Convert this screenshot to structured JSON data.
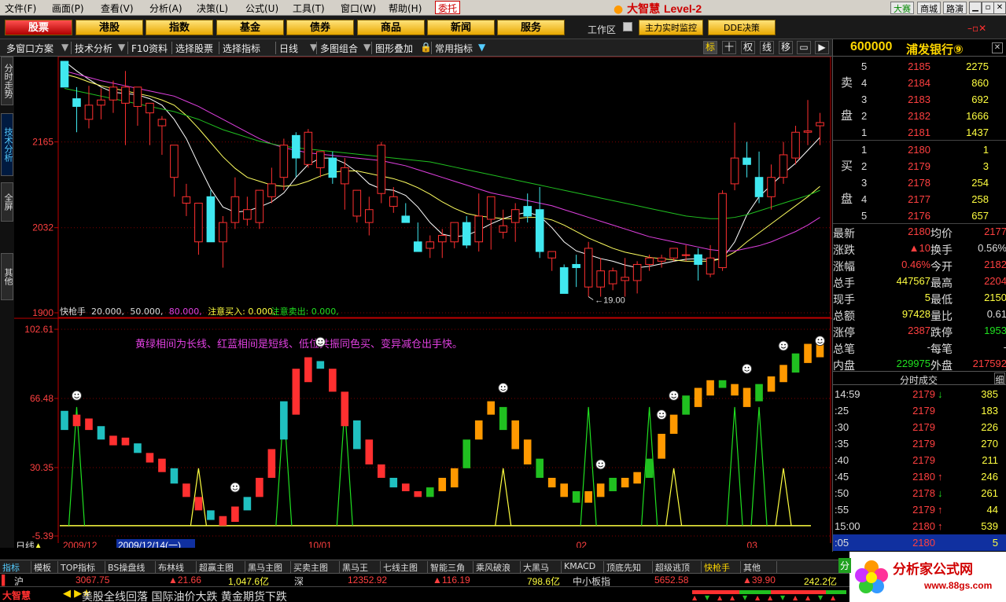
{
  "menu": {
    "items": [
      "文件(F)",
      "画面(P)",
      "查看(V)",
      "分析(A)",
      "决策(L)",
      "公式(U)",
      "工具(T)",
      "窗口(W)",
      "帮助(H)"
    ],
    "trust_tag": "委托",
    "app_title": "大智慧",
    "app_level": "Level-2",
    "right_buttons": [
      "大赛",
      "商城",
      "路演"
    ]
  },
  "nav": {
    "buttons": [
      "股票",
      "港股",
      "指数",
      "基金",
      "债券",
      "商品",
      "新闻",
      "服务"
    ],
    "workspace_label": "工作区",
    "extra_buttons": [
      "主力实时监控",
      "DDE决策"
    ]
  },
  "toolbar": {
    "items": [
      "多窗口方案",
      "技术分析",
      "F10资料",
      "选择股票",
      "选择指标",
      "日线",
      "多图组合",
      "图形叠加",
      "常用指标"
    ],
    "icons": [
      "标",
      "十",
      "权",
      "线",
      "移"
    ]
  },
  "vtabs": [
    "分时走势",
    "技术分析",
    "全屏",
    "其他"
  ],
  "chart_data": [
    {
      "type": "candlestick",
      "title": "",
      "y_ticks": [
        2165,
        2032,
        1900
      ],
      "ylim": [
        1900,
        2290
      ],
      "annotation": "19.00",
      "x_labels": [
        "2009/12",
        "2009/12/14(一)",
        "10/01",
        "02",
        "03"
      ],
      "x_label_slots": [
        0,
        6,
        20,
        42,
        56
      ],
      "candles": [
        [
          2290,
          2290,
          2260,
          2250
        ],
        [
          2232,
          2250,
          2180,
          2220
        ],
        [
          2200,
          2252,
          2186,
          2222
        ],
        [
          2222,
          2248,
          2200,
          2230
        ],
        [
          2230,
          2260,
          2210,
          2250
        ],
        [
          2225,
          2275,
          2160,
          2250
        ],
        [
          2220,
          2245,
          2190,
          2250
        ],
        [
          2210,
          2225,
          2160,
          2225
        ],
        [
          2190,
          2205,
          2145,
          2200
        ],
        [
          2110,
          2150,
          2080,
          2160
        ],
        [
          2070,
          2100,
          2050,
          2080
        ],
        [
          2010,
          2030,
          1990,
          2070
        ],
        [
          2080,
          2090,
          2010,
          2010
        ],
        [
          2010,
          2050,
          1970,
          2040
        ],
        [
          2040,
          2110,
          2030,
          2080
        ],
        [
          2045,
          2080,
          2035,
          2060
        ],
        [
          2040,
          2090,
          2030,
          2090
        ],
        [
          2080,
          2125,
          2070,
          2100
        ],
        [
          2110,
          2170,
          2090,
          2160
        ],
        [
          2175,
          2180,
          2110,
          2140
        ],
        [
          2130,
          2185,
          2125,
          2180
        ],
        [
          2125,
          2140,
          2110,
          2150
        ],
        [
          2140,
          2150,
          2100,
          2110
        ],
        [
          2100,
          2140,
          2060,
          2125
        ],
        [
          2050,
          2080,
          2040,
          2090
        ],
        [
          2040,
          2080,
          2020,
          2060
        ],
        [
          2085,
          2165,
          2070,
          2160
        ],
        [
          2065,
          2095,
          2055,
          2080
        ],
        [
          2050,
          2070,
          2040,
          2040
        ],
        [
          2010,
          2040,
          2000,
          1995
        ],
        [
          2000,
          2020,
          1985,
          2010
        ],
        [
          2010,
          2030,
          1985,
          2020
        ],
        [
          2010,
          2040,
          2000,
          2040
        ],
        [
          2040,
          2050,
          2000,
          2005
        ],
        [
          2010,
          2085,
          1995,
          2050
        ],
        [
          2045,
          2080,
          1998,
          2080
        ],
        [
          2025,
          2060,
          2015,
          2035
        ],
        [
          2040,
          2070,
          2010,
          2060
        ],
        [
          2065,
          2085,
          2040,
          2050
        ],
        [
          2060,
          2095,
          1985,
          1995
        ],
        [
          1985,
          1995,
          1965,
          1995
        ],
        [
          1970,
          1975,
          1940,
          1930
        ],
        [
          1975,
          1990,
          1940,
          1970
        ],
        [
          1940,
          2010,
          1925,
          2000
        ],
        [
          1940,
          1985,
          1925,
          1965
        ],
        [
          1945,
          1970,
          1935,
          1965
        ],
        [
          1950,
          1985,
          1925,
          1955
        ],
        [
          1950,
          1980,
          1930,
          1975
        ],
        [
          1975,
          1990,
          1965,
          1985
        ],
        [
          1980,
          1990,
          1970,
          1985
        ],
        [
          1985,
          2000,
          1980,
          2000
        ],
        [
          1990,
          2005,
          1980,
          1990
        ],
        [
          1990,
          2000,
          1950,
          1975
        ],
        [
          1960,
          2005,
          1955,
          1985
        ],
        [
          1970,
          2090,
          1965,
          2085
        ],
        [
          2100,
          2195,
          2090,
          2140
        ],
        [
          2140,
          2165,
          2110,
          2130
        ],
        [
          2110,
          2150,
          2070,
          2080
        ],
        [
          2080,
          2130,
          2060,
          2110
        ],
        [
          2110,
          2165,
          2100,
          2145
        ],
        [
          2140,
          2190,
          2130,
          2180
        ],
        [
          2180,
          2230,
          2160,
          2182
        ],
        [
          2190,
          2210,
          2160,
          2195
        ]
      ],
      "series": [
        {
          "values": [
            2290,
            2275,
            2262,
            2250,
            2242,
            2240,
            2238,
            2232,
            2222,
            2200,
            2170,
            2130,
            2092,
            2064,
            2056,
            2058,
            2064,
            2072,
            2086,
            2110,
            2130,
            2140,
            2140,
            2132,
            2118,
            2100,
            2092,
            2090,
            2082,
            2064,
            2040,
            2022,
            2018,
            2020,
            2028,
            2038,
            2046,
            2052,
            2056,
            2050,
            2032,
            2010,
            1996,
            1990,
            1984,
            1980,
            1974,
            1970,
            1972,
            1976,
            1980,
            1983,
            1984,
            1982,
            1984,
            2010,
            2052,
            2080,
            2098,
            2116,
            2132,
            2152,
            2172
          ]
        },
        {
          "values": [
            2270,
            2265,
            2258,
            2252,
            2248,
            2244,
            2240,
            2236,
            2230,
            2222,
            2206,
            2186,
            2164,
            2142,
            2124,
            2110,
            2104,
            2098,
            2096,
            2098,
            2104,
            2112,
            2118,
            2120,
            2120,
            2116,
            2112,
            2108,
            2102,
            2094,
            2084,
            2072,
            2062,
            2054,
            2050,
            2048,
            2046,
            2046,
            2048,
            2048,
            2044,
            2036,
            2026,
            2016,
            2008,
            2000,
            1994,
            1990,
            1986,
            1984,
            1982,
            1980,
            1980,
            1980,
            1984,
            1994,
            2010,
            2024,
            2038,
            2052,
            2066,
            2080,
            2096
          ]
        },
        {
          "values": [
            2275,
            2270,
            2265,
            2260,
            2256,
            2252,
            2248,
            2244,
            2240,
            2236,
            2228,
            2220,
            2210,
            2200,
            2190,
            2180,
            2170,
            2162,
            2156,
            2152,
            2148,
            2146,
            2144,
            2142,
            2140,
            2138,
            2136,
            2132,
            2128,
            2122,
            2116,
            2110,
            2104,
            2098,
            2092,
            2086,
            2082,
            2078,
            2074,
            2070,
            2066,
            2060,
            2054,
            2048,
            2042,
            2036,
            2030,
            2024,
            2018,
            2014,
            2010,
            2006,
            2002,
            1998,
            1996,
            1996,
            2000,
            2004,
            2010,
            2018,
            2026,
            2036,
            2048
          ]
        },
        {
          "values": [
            2248,
            2244,
            2240,
            2236,
            2232,
            2228,
            2224,
            2220,
            2216,
            2212,
            2206,
            2200,
            2192,
            2184,
            2178,
            2172,
            2166,
            2162,
            2158,
            2156,
            2154,
            2152,
            2150,
            2148,
            2146,
            2144,
            2142,
            2140,
            2138,
            2136,
            2134,
            2130,
            2126,
            2122,
            2118,
            2114,
            2110,
            2106,
            2102,
            2098,
            2094,
            2090,
            2086,
            2082,
            2078,
            2074,
            2070,
            2066,
            2062,
            2058,
            2054,
            2050,
            2048,
            2046,
            2046,
            2048,
            2052,
            2058,
            2064,
            2070,
            2076,
            2082,
            2090
          ]
        }
      ]
    },
    {
      "type": "indicator",
      "title": "快枪手",
      "params": [
        "20.000,",
        "50.000,",
        "80.000,",
        "注意买入: 0.000,",
        "注意卖出: 0.000,"
      ],
      "note": "黄绿相间为长线、红蓝相间是短线、低位共振同色买、变异减仓出手快。",
      "y_ticks": [
        "102.61",
        "66.48",
        "30.35",
        "-5.39"
      ],
      "y_tick_values": [
        102.61,
        66.48,
        30.35,
        -5.39
      ],
      "ylim": [
        -5.39,
        102.61
      ],
      "bars": [
        [
          50,
          60
        ],
        [
          52,
          58
        ],
        [
          50,
          56
        ],
        [
          45,
          52
        ],
        [
          42,
          47
        ],
        [
          42,
          46
        ],
        [
          38,
          43
        ],
        [
          33,
          38
        ],
        [
          28,
          35
        ],
        [
          22,
          30
        ],
        [
          15,
          22
        ],
        [
          8,
          15
        ],
        [
          3,
          8
        ],
        [
          0,
          5
        ],
        [
          2,
          10
        ],
        [
          8,
          15
        ],
        [
          15,
          25
        ],
        [
          25,
          40
        ],
        [
          45,
          65
        ],
        [
          58,
          82
        ],
        [
          75,
          88
        ],
        [
          82,
          86
        ],
        [
          70,
          82
        ],
        [
          52,
          70
        ],
        [
          40,
          55
        ],
        [
          32,
          45
        ],
        [
          25,
          32
        ],
        [
          20,
          25
        ],
        [
          18,
          22
        ],
        [
          15,
          18
        ],
        [
          15,
          20
        ],
        [
          18,
          25
        ],
        [
          20,
          30
        ],
        [
          30,
          45
        ],
        [
          45,
          55
        ],
        [
          58,
          65
        ],
        [
          50,
          62
        ],
        [
          40,
          55
        ],
        [
          32,
          45
        ],
        [
          25,
          35
        ],
        [
          20,
          25
        ],
        [
          15,
          22
        ],
        [
          12,
          18
        ],
        [
          12,
          18
        ],
        [
          15,
          22
        ],
        [
          18,
          25
        ],
        [
          20,
          25
        ],
        [
          22,
          28
        ],
        [
          25,
          35
        ],
        [
          35,
          48
        ],
        [
          48,
          58
        ],
        [
          58,
          68
        ],
        [
          62,
          72
        ],
        [
          68,
          76
        ],
        [
          72,
          76
        ],
        [
          68,
          74
        ],
        [
          62,
          72
        ],
        [
          65,
          74
        ],
        [
          70,
          78
        ],
        [
          75,
          84
        ],
        [
          80,
          90
        ],
        [
          85,
          95
        ],
        [
          88,
          98
        ]
      ],
      "spikes": [
        1,
        11,
        18,
        23,
        36,
        43,
        48,
        50,
        55,
        57,
        59
      ],
      "smileys": [
        1,
        14,
        21,
        36,
        44,
        49,
        50,
        56,
        59,
        63
      ]
    }
  ],
  "quote": {
    "code": "600000",
    "name": "浦发银行⑨",
    "sell_label": [
      "卖",
      "盘"
    ],
    "buy_label": [
      "买",
      "盘"
    ],
    "asks": [
      {
        "lv": "5",
        "price": "2185",
        "vol": "2275"
      },
      {
        "lv": "4",
        "price": "2184",
        "vol": "860"
      },
      {
        "lv": "3",
        "price": "2183",
        "vol": "692"
      },
      {
        "lv": "2",
        "price": "2182",
        "vol": "1666"
      },
      {
        "lv": "1",
        "price": "2181",
        "vol": "1437"
      }
    ],
    "bids": [
      {
        "lv": "1",
        "price": "2180",
        "vol": "1"
      },
      {
        "lv": "2",
        "price": "2179",
        "vol": "3"
      },
      {
        "lv": "3",
        "price": "2178",
        "vol": "254"
      },
      {
        "lv": "4",
        "price": "2177",
        "vol": "258"
      },
      {
        "lv": "5",
        "price": "2176",
        "vol": "657"
      }
    ],
    "stats": [
      {
        "k1": "最新",
        "v1": "2180",
        "c1": "red",
        "k2": "均价",
        "v2": "2177",
        "c2": "red"
      },
      {
        "k1": "涨跌",
        "v1": "▲10",
        "c1": "red",
        "k2": "换手",
        "v2": "0.56%",
        "c2": "wht"
      },
      {
        "k1": "涨幅",
        "v1": "0.46%",
        "c1": "red",
        "k2": "今开",
        "v2": "2182",
        "c2": "red"
      },
      {
        "k1": "总手",
        "v1": "447567",
        "c1": "yel",
        "k2": "最高",
        "v2": "2204",
        "c2": "red"
      },
      {
        "k1": "现手",
        "v1": "5",
        "c1": "yel",
        "k2": "最低",
        "v2": "2150",
        "c2": "yel"
      },
      {
        "k1": "总额",
        "v1": "97428",
        "c1": "yel",
        "k2": "量比",
        "v2": "0.61",
        "c2": "wht"
      },
      {
        "k1": "涨停",
        "v1": "2387",
        "c1": "red",
        "k2": "跌停",
        "v2": "1953",
        "c2": "grn"
      },
      {
        "k1": "总笔",
        "v1": "-",
        "c1": "wht",
        "k2": "每笔",
        "v2": "-",
        "c2": "wht"
      },
      {
        "k1": "内盘",
        "v1": "229975",
        "c1": "grn",
        "k2": "外盘",
        "v2": "217592",
        "c2": "red"
      }
    ],
    "ticks_title": "分时成交",
    "ticks_btn": "细",
    "ticks": [
      {
        "t": "14:59",
        "p": "2179",
        "a": "dn",
        "v": "385"
      },
      {
        "t": ":25",
        "p": "2179",
        "a": "",
        "v": "183"
      },
      {
        "t": ":30",
        "p": "2179",
        "a": "",
        "v": "226"
      },
      {
        "t": ":35",
        "p": "2179",
        "a": "",
        "v": "270"
      },
      {
        "t": ":40",
        "p": "2179",
        "a": "",
        "v": "211"
      },
      {
        "t": ":45",
        "p": "2180",
        "a": "up",
        "v": "246"
      },
      {
        "t": ":50",
        "p": "2178",
        "a": "dn",
        "v": "261"
      },
      {
        "t": ":55",
        "p": "2179",
        "a": "up",
        "v": "44"
      },
      {
        "t": "15:00",
        "p": "2180",
        "a": "up",
        "v": "539"
      },
      {
        "t": ":05",
        "p": "2180",
        "a": "",
        "v": "5"
      }
    ]
  },
  "formula_tabs": [
    "指标",
    "模板",
    "TOP指标",
    "BS操盘线",
    "布林线",
    "超赢主图",
    "黑马主图",
    "买卖主图",
    "黑马王",
    "七线主图",
    "智能三角",
    "乘风破浪",
    "大黑马",
    "KMACD",
    "顶底先知",
    "超级逃顶",
    "快枪手",
    "其他"
  ],
  "status": {
    "sh_label": "沪",
    "sh_index": "3067.75",
    "sh_change": "▲21.66",
    "sh_amount": "1,047.6亿",
    "sz_label": "深",
    "sz_index": "12352.92",
    "sz_change": "▲116.19",
    "sz_amount": "798.6亿",
    "sme_label": "中小板指",
    "sme_index": "5652.58",
    "sme_change": "▲39.90",
    "sme_amount": "242.2亿"
  },
  "news": {
    "logo": "大智慧",
    "text": "美股全线回落 国际油价大跌 黄金期货下跌"
  },
  "watermark": {
    "fen": "分",
    "title": "分析家公式网",
    "url": "www.88gs.com"
  },
  "period_label": "日线",
  "colors": {
    "up": "#ff3030",
    "down": "#40e8f0",
    "ma_white": "#ffffff",
    "ma_yellow": "#ffff60",
    "ma_magenta": "#e040e0",
    "ma_green": "#20c020"
  }
}
